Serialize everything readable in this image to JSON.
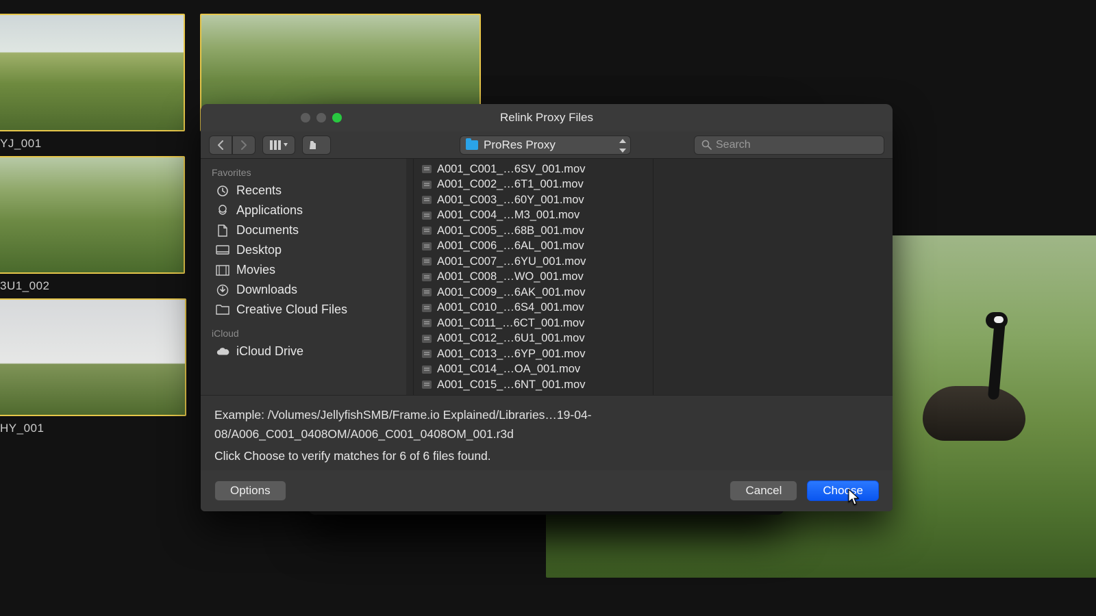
{
  "clips": {
    "thumb1_label": "YJ_001",
    "thumb3_label": "3U1_002",
    "thumb4_label": "HY_001"
  },
  "dialog": {
    "title": "Relink Proxy Files",
    "path_label": "ProRes Proxy",
    "search_placeholder": "Search",
    "sidebar": {
      "section1": "Favorites",
      "items1": [
        "Recents",
        "Applications",
        "Documents",
        "Desktop",
        "Movies",
        "Downloads",
        "Creative Cloud Files"
      ],
      "section2": "iCloud",
      "items2": [
        "iCloud Drive"
      ]
    },
    "files": [
      "A001_C001_…6SV_001.mov",
      "A001_C002_…6T1_001.mov",
      "A001_C003_…60Y_001.mov",
      "A001_C004_…M3_001.mov",
      "A001_C005_…68B_001.mov",
      "A001_C006_…6AL_001.mov",
      "A001_C007_…6YU_001.mov",
      "A001_C008_…WO_001.mov",
      "A001_C009_…6AK_001.mov",
      "A001_C010_…6S4_001.mov",
      "A001_C011_…6CT_001.mov",
      "A001_C012_…6U1_001.mov",
      "A001_C013_…6YP_001.mov",
      "A001_C014_…OA_001.mov",
      "A001_C015_…6NT_001.mov"
    ],
    "example_label": "Example: /Volumes/JellyfishSMB/Frame.io Explained/Libraries…19-04-08/A006_C001_0408OM/A006_C001_0408OM_001.r3d",
    "status_label": "Click Choose to verify matches for 6 of 6 files found.",
    "options_label": "Options",
    "cancel_label": "Cancel",
    "choose_label": "Choose"
  }
}
